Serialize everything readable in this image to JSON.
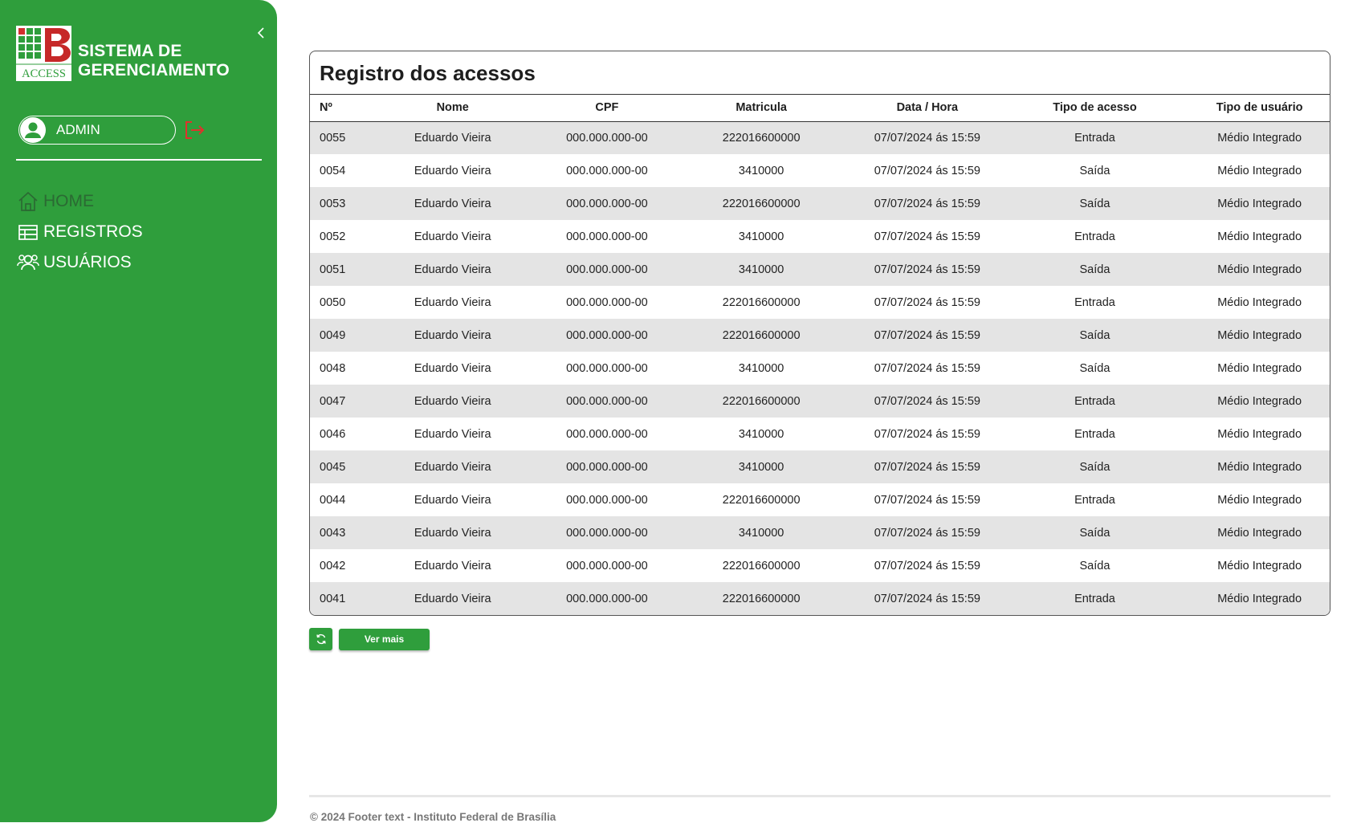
{
  "brand": {
    "line1": "SISTEMA DE",
    "line2": "GERENCIAMENTO",
    "logo_text": "ACCESS"
  },
  "user": {
    "label": "ADMIN"
  },
  "nav": [
    {
      "label": "HOME",
      "icon": "home-icon"
    },
    {
      "label": "REGISTROS",
      "icon": "table-icon"
    },
    {
      "label": "USUÁRIOS",
      "icon": "users-icon"
    }
  ],
  "card": {
    "title": "Registro dos acessos"
  },
  "columns": [
    "Nº",
    "Nome",
    "CPF",
    "Matricula",
    "Data / Hora",
    "Tipo de acesso",
    "Tipo de usuário"
  ],
  "rows": [
    [
      "0055",
      "Eduardo Vieira",
      "000.000.000-00",
      "222016600000",
      "07/07/2024 ás 15:59",
      "Entrada",
      "Médio Integrado"
    ],
    [
      "0054",
      "Eduardo Vieira",
      "000.000.000-00",
      "3410000",
      "07/07/2024 ás 15:59",
      "Saída",
      "Médio Integrado"
    ],
    [
      "0053",
      "Eduardo Vieira",
      "000.000.000-00",
      "222016600000",
      "07/07/2024 ás 15:59",
      "Saída",
      "Médio Integrado"
    ],
    [
      "0052",
      "Eduardo Vieira",
      "000.000.000-00",
      "3410000",
      "07/07/2024 ás 15:59",
      "Entrada",
      "Médio Integrado"
    ],
    [
      "0051",
      "Eduardo Vieira",
      "000.000.000-00",
      "3410000",
      "07/07/2024 ás 15:59",
      "Saída",
      "Médio Integrado"
    ],
    [
      "0050",
      "Eduardo Vieira",
      "000.000.000-00",
      "222016600000",
      "07/07/2024 ás 15:59",
      "Entrada",
      "Médio Integrado"
    ],
    [
      "0049",
      "Eduardo Vieira",
      "000.000.000-00",
      "222016600000",
      "07/07/2024 ás 15:59",
      "Saída",
      "Médio Integrado"
    ],
    [
      "0048",
      "Eduardo Vieira",
      "000.000.000-00",
      "3410000",
      "07/07/2024 ás 15:59",
      "Saída",
      "Médio Integrado"
    ],
    [
      "0047",
      "Eduardo Vieira",
      "000.000.000-00",
      "222016600000",
      "07/07/2024 ás 15:59",
      "Entrada",
      "Médio Integrado"
    ],
    [
      "0046",
      "Eduardo Vieira",
      "000.000.000-00",
      "3410000",
      "07/07/2024 ás 15:59",
      "Entrada",
      "Médio Integrado"
    ],
    [
      "0045",
      "Eduardo Vieira",
      "000.000.000-00",
      "3410000",
      "07/07/2024 ás 15:59",
      "Saída",
      "Médio Integrado"
    ],
    [
      "0044",
      "Eduardo Vieira",
      "000.000.000-00",
      "222016600000",
      "07/07/2024 ás 15:59",
      "Entrada",
      "Médio Integrado"
    ],
    [
      "0043",
      "Eduardo Vieira",
      "000.000.000-00",
      "3410000",
      "07/07/2024 ás 15:59",
      "Saída",
      "Médio Integrado"
    ],
    [
      "0042",
      "Eduardo Vieira",
      "000.000.000-00",
      "222016600000",
      "07/07/2024 ás 15:59",
      "Saída",
      "Médio Integrado"
    ],
    [
      "0041",
      "Eduardo Vieira",
      "000.000.000-00",
      "222016600000",
      "07/07/2024 ás 15:59",
      "Entrada",
      "Médio Integrado"
    ]
  ],
  "buttons": {
    "more_label": "Ver mais",
    "refresh_icon": "refresh-icon"
  },
  "footer": {
    "text": "© 2024 Footer text - Instituto Federal de Brasília"
  },
  "colors": {
    "primary": "#2f9e3c",
    "row_alt": "#e4e4e4",
    "logout": "#e0322c",
    "home_active": "#2b6a33"
  }
}
